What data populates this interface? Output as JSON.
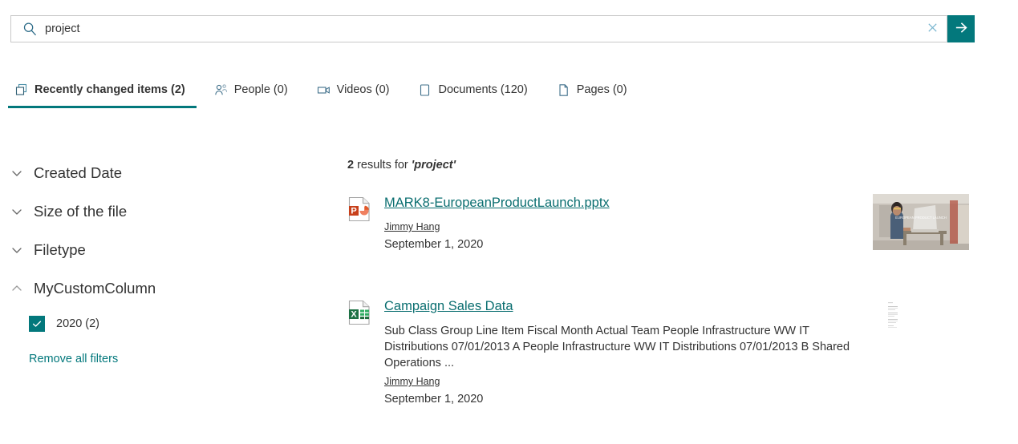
{
  "search": {
    "value": "project",
    "placeholder": "Search",
    "search_icon": "search-icon",
    "clear_icon": "close-icon",
    "submit_icon": "arrow-right-icon",
    "accent_color": "#03787c"
  },
  "tabs": [
    {
      "label": "Recently changed items (2)",
      "icon": "recent-items-icon",
      "active": true
    },
    {
      "label": "People (0)",
      "icon": "people-icon",
      "active": false
    },
    {
      "label": "Videos (0)",
      "icon": "video-icon",
      "active": false
    },
    {
      "label": "Documents (120)",
      "icon": "document-icon",
      "active": false
    },
    {
      "label": "Pages (0)",
      "icon": "page-icon",
      "active": false
    }
  ],
  "filters": {
    "groups": [
      {
        "label": "Created Date",
        "expanded": false,
        "chevron": "chevron-down-icon"
      },
      {
        "label": "Size of the file",
        "expanded": false,
        "chevron": "chevron-down-icon"
      },
      {
        "label": "Filetype",
        "expanded": false,
        "chevron": "chevron-down-icon"
      },
      {
        "label": "MyCustomColumn",
        "expanded": true,
        "chevron": "chevron-up-icon"
      }
    ],
    "options": [
      {
        "label": "2020 (2)",
        "checked": true
      }
    ],
    "remove_all_label": "Remove all filters"
  },
  "results": {
    "count_number": "2",
    "count_text": " results for ",
    "count_term": "'project'",
    "items": [
      {
        "title": "MARK8-EuropeanProductLaunch.pptx",
        "file_icon": "powerpoint-file-icon",
        "snippet": "",
        "author": "Jimmy Hang",
        "date": "September 1, 2020",
        "thumbnail": "presentation-photo-thumbnail",
        "thumbnail_overlay_text": "EUROPEAN PRODUCT LAUNCH"
      },
      {
        "title": "Campaign Sales Data",
        "file_icon": "excel-file-icon",
        "snippet": "Sub Class Group Line Item Fiscal Month Actual Team People Infrastructure WW IT Distributions 07/01/2013 A People Infrastructure WW IT Distributions 07/01/2013 B Shared Operations ...",
        "author": "Jimmy Hang",
        "date": "September 1, 2020",
        "thumbnail": "spreadsheet-document-thumbnail",
        "thumbnail_overlay_text": ""
      }
    ]
  }
}
